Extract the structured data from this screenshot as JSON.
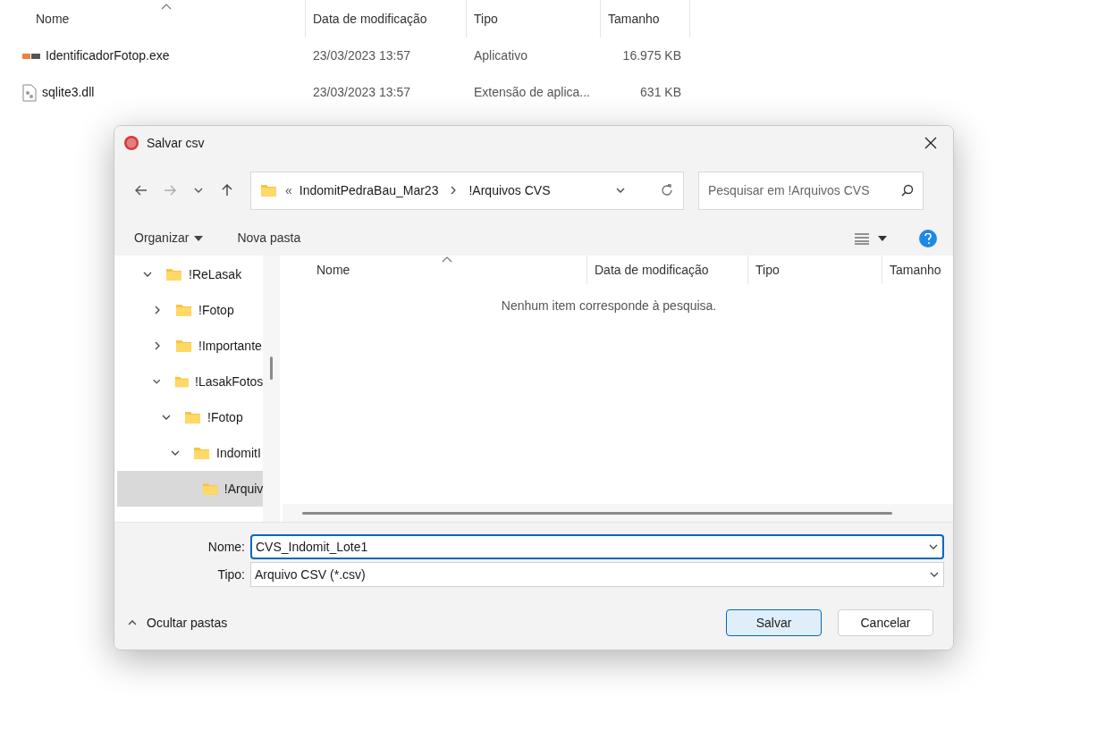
{
  "explorer": {
    "columns": [
      {
        "label": "Nome",
        "sorted": true
      },
      {
        "label": "Data de modificação",
        "sorted": false
      },
      {
        "label": "Tipo",
        "sorted": false
      },
      {
        "label": "Tamanho",
        "sorted": false
      }
    ],
    "rows": [
      {
        "kind": "app",
        "name": "IdentificadorFotop.exe",
        "date": "23/03/2023 13:57",
        "type": "Aplicativo",
        "size": "16.975 KB"
      },
      {
        "kind": "dll",
        "name": "sqlite3.dll",
        "date": "23/03/2023 13:57",
        "type": "Extensão de aplica...",
        "size": "631 KB"
      }
    ]
  },
  "dialog": {
    "title": "Salvar csv",
    "address": {
      "overflow": "«",
      "crumbs": [
        "IndomitPedraBau_Mar23",
        "!Arquivos CVS"
      ]
    },
    "search": {
      "placeholder": "Pesquisar em !Arquivos CVS"
    },
    "toolbar": {
      "organize": "Organizar",
      "new_folder": "Nova pasta"
    },
    "tree": [
      {
        "label": "!ReLasak",
        "expanded": true,
        "selected": false,
        "children": [
          {
            "label": "!Fotop",
            "expanded": false,
            "selected": false
          },
          {
            "label": "!Importante",
            "expanded": false,
            "selected": false
          },
          {
            "label": "!LasakFotos",
            "expanded": true,
            "selected": false,
            "children": [
              {
                "label": "!Fotop",
                "expanded": true,
                "selected": false,
                "children": [
                  {
                    "label": "IndomitI",
                    "expanded": true,
                    "selected": false,
                    "children": [
                      {
                        "label": "!Arquiv",
                        "selected": true
                      }
                    ]
                  }
                ]
              }
            ]
          }
        ]
      }
    ],
    "columns": [
      {
        "label": "Nome",
        "sorted": true
      },
      {
        "label": "Data de modificação",
        "sorted": false
      },
      {
        "label": "Tipo",
        "sorted": false
      },
      {
        "label": "Tamanho",
        "sorted": false
      }
    ],
    "empty_message": "Nenhum item corresponde à pesquisa.",
    "name_field": {
      "label": "Nome:",
      "value": "CVS_Indomit_Lote1"
    },
    "type_field": {
      "label": "Tipo:",
      "value": "Arquivo CSV (*.csv)"
    },
    "hide_folders": "Ocultar pastas",
    "buttons": [
      {
        "label": "Salvar",
        "default": true
      },
      {
        "label": "Cancelar",
        "default": false
      }
    ]
  }
}
